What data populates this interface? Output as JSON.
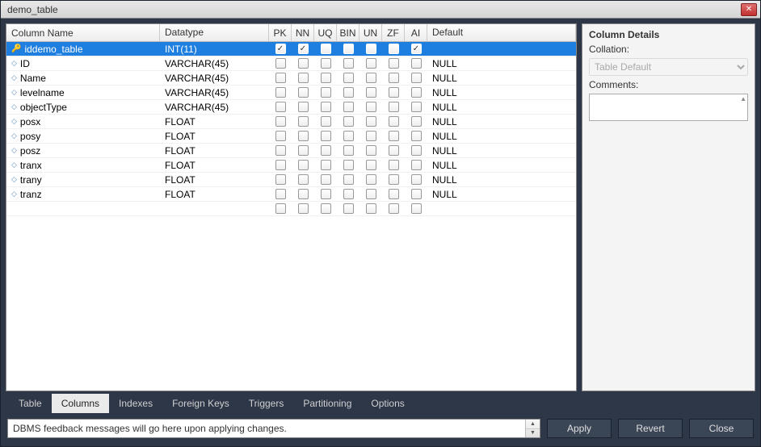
{
  "window": {
    "title": "demo_table"
  },
  "grid": {
    "headers": {
      "name": "Column Name",
      "datatype": "Datatype",
      "pk": "PK",
      "nn": "NN",
      "uq": "UQ",
      "bin": "BIN",
      "un": "UN",
      "zf": "ZF",
      "ai": "AI",
      "default": "Default"
    },
    "rows": [
      {
        "icon": "key",
        "name": "iddemo_table",
        "datatype": "INT(11)",
        "pk": true,
        "nn": true,
        "uq": false,
        "bin": false,
        "un": false,
        "zf": false,
        "ai": true,
        "default": "",
        "selected": true
      },
      {
        "icon": "diamond",
        "name": "ID",
        "datatype": "VARCHAR(45)",
        "pk": false,
        "nn": false,
        "uq": false,
        "bin": false,
        "un": false,
        "zf": false,
        "ai": false,
        "default": "NULL",
        "selected": false
      },
      {
        "icon": "diamond",
        "name": "Name",
        "datatype": "VARCHAR(45)",
        "pk": false,
        "nn": false,
        "uq": false,
        "bin": false,
        "un": false,
        "zf": false,
        "ai": false,
        "default": "NULL",
        "selected": false
      },
      {
        "icon": "diamond",
        "name": "levelname",
        "datatype": "VARCHAR(45)",
        "pk": false,
        "nn": false,
        "uq": false,
        "bin": false,
        "un": false,
        "zf": false,
        "ai": false,
        "default": "NULL",
        "selected": false
      },
      {
        "icon": "diamond",
        "name": "objectType",
        "datatype": "VARCHAR(45)",
        "pk": false,
        "nn": false,
        "uq": false,
        "bin": false,
        "un": false,
        "zf": false,
        "ai": false,
        "default": "NULL",
        "selected": false
      },
      {
        "icon": "diamond",
        "name": "posx",
        "datatype": "FLOAT",
        "pk": false,
        "nn": false,
        "uq": false,
        "bin": false,
        "un": false,
        "zf": false,
        "ai": false,
        "default": "NULL",
        "selected": false
      },
      {
        "icon": "diamond",
        "name": "posy",
        "datatype": "FLOAT",
        "pk": false,
        "nn": false,
        "uq": false,
        "bin": false,
        "un": false,
        "zf": false,
        "ai": false,
        "default": "NULL",
        "selected": false
      },
      {
        "icon": "diamond",
        "name": "posz",
        "datatype": "FLOAT",
        "pk": false,
        "nn": false,
        "uq": false,
        "bin": false,
        "un": false,
        "zf": false,
        "ai": false,
        "default": "NULL",
        "selected": false
      },
      {
        "icon": "diamond",
        "name": "tranx",
        "datatype": "FLOAT",
        "pk": false,
        "nn": false,
        "uq": false,
        "bin": false,
        "un": false,
        "zf": false,
        "ai": false,
        "default": "NULL",
        "selected": false
      },
      {
        "icon": "diamond",
        "name": "trany",
        "datatype": "FLOAT",
        "pk": false,
        "nn": false,
        "uq": false,
        "bin": false,
        "un": false,
        "zf": false,
        "ai": false,
        "default": "NULL",
        "selected": false
      },
      {
        "icon": "diamond",
        "name": "tranz",
        "datatype": "FLOAT",
        "pk": false,
        "nn": false,
        "uq": false,
        "bin": false,
        "un": false,
        "zf": false,
        "ai": false,
        "default": "NULL",
        "selected": false
      },
      {
        "icon": "",
        "name": "",
        "datatype": "",
        "pk": false,
        "nn": false,
        "uq": false,
        "bin": false,
        "un": false,
        "zf": false,
        "ai": false,
        "default": "",
        "selected": false
      }
    ]
  },
  "details": {
    "title": "Column Details",
    "collation_label": "Collation:",
    "collation_value": "Table Default",
    "comments_label": "Comments:",
    "comments_value": ""
  },
  "tabs": [
    {
      "label": "Table",
      "active": false
    },
    {
      "label": "Columns",
      "active": true
    },
    {
      "label": "Indexes",
      "active": false
    },
    {
      "label": "Foreign Keys",
      "active": false
    },
    {
      "label": "Triggers",
      "active": false
    },
    {
      "label": "Partitioning",
      "active": false
    },
    {
      "label": "Options",
      "active": false
    }
  ],
  "footer": {
    "message": "DBMS feedback messages will go here upon applying changes.",
    "apply": "Apply",
    "revert": "Revert",
    "close": "Close"
  }
}
